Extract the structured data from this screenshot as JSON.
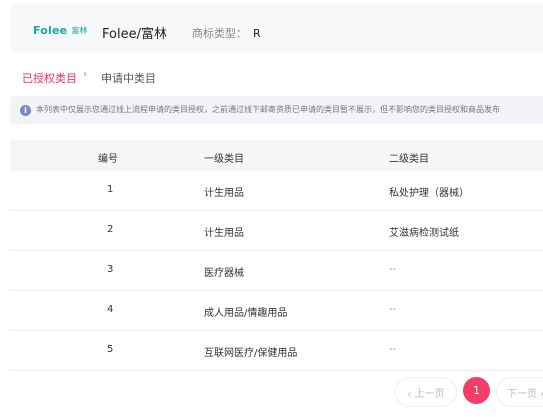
{
  "brand": {
    "logo_word": "Folee",
    "logo_cn": "富林",
    "name": "Folee/富林",
    "trademark_label": "商标类型：",
    "trademark_value": "R"
  },
  "tabs": [
    {
      "label": "已授权类目",
      "active": true
    },
    {
      "label": "申请中类目",
      "active": false
    }
  ],
  "tab_separator": "›",
  "notice": {
    "icon": "info-icon",
    "text": "本列表中仅展示您通过线上流程申请的类目授权，之前通过线下邮寄资质已申请的类目暂不展示，但不影响您的类目授权和商品发布"
  },
  "table": {
    "columns": [
      "编号",
      "一级类目",
      "二级类目"
    ],
    "rows": [
      [
        "1",
        "计生用品",
        "私处护理（器械）"
      ],
      [
        "2",
        "计生用品",
        "艾滋病检测试纸"
      ],
      [
        "3",
        "医疗器械",
        "--"
      ],
      [
        "4",
        "成人用品/情趣用品",
        "--"
      ],
      [
        "5",
        "互联网医疗/保健用品",
        "--"
      ]
    ]
  },
  "pagination": {
    "prev": "‹ 上一页",
    "current": "1",
    "next": "下一页 ›"
  },
  "colors": {
    "accent": "#f23d69",
    "tab_active": "#e5365c",
    "logo": "#1aa7a0"
  }
}
